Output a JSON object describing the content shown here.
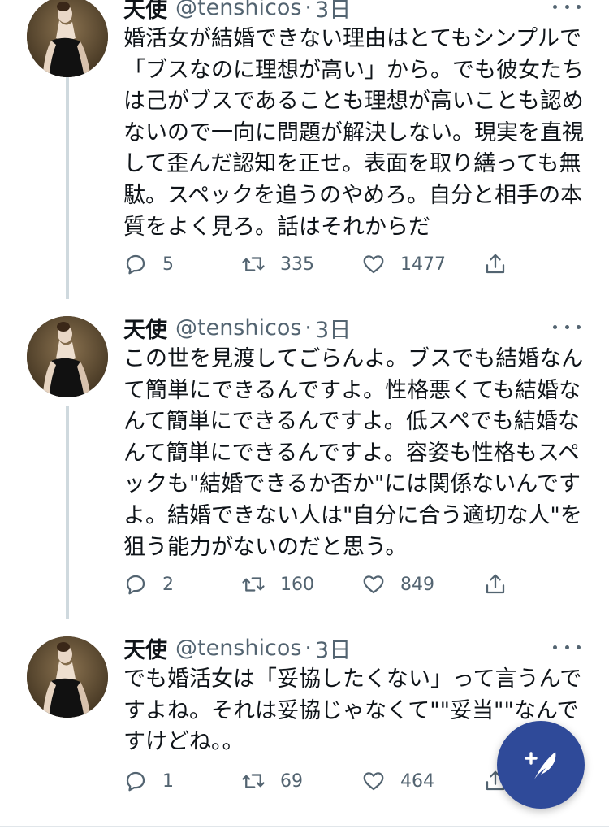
{
  "colors": {
    "accent": "#2f4a99",
    "text_primary": "#0f1419",
    "text_secondary": "#536471",
    "thread_line": "#cfd9de"
  },
  "tweets": [
    {
      "name": "天使",
      "handle": "@tenshicos",
      "separator": "·",
      "time": "3日",
      "text": "婚活女が結婚できない理由はとてもシンプルで「ブスなのに理想が高い」から。でも彼女たちは己がブスであることも理想が高いことも認めないので一向に問題が解決しない。現実を直視して歪んだ認知を正せ。表面を取り繕っても無駄。スペックを追うのやめろ。自分と相手の本質をよく見ろ。話はそれからだ",
      "replies": "5",
      "retweets": "335",
      "likes": "1477"
    },
    {
      "name": "天使",
      "handle": "@tenshicos",
      "separator": "·",
      "time": "3日",
      "text": "この世を見渡してごらんよ。ブスでも結婚なんて簡単にできるんですよ。性格悪くても結婚なんて簡単にできるんですよ。低スペでも結婚なんて簡単にできるんですよ。容姿も性格もスペックも\"結婚できるか否か\"には関係ないんですよ。結婚できない人は\"自分に合う適切な人\"を狙う能力がないのだと思う。",
      "replies": "2",
      "retweets": "160",
      "likes": "849"
    },
    {
      "name": "天使",
      "handle": "@tenshicos",
      "separator": "·",
      "time": "3日",
      "text": "でも婚活女は「妥協したくない」って言うんですよね。それは妥協じゃなくて\"\"妥当\"\"なんですけどね。。",
      "replies": "1",
      "retweets": "69",
      "likes": "464"
    }
  ],
  "icons": {
    "avatar": "portrait-avatar",
    "more": "more-options-icon",
    "reply": "reply-icon",
    "retweet": "retweet-icon",
    "like": "heart-icon",
    "share": "share-icon",
    "compose": "compose-tweet-icon"
  }
}
